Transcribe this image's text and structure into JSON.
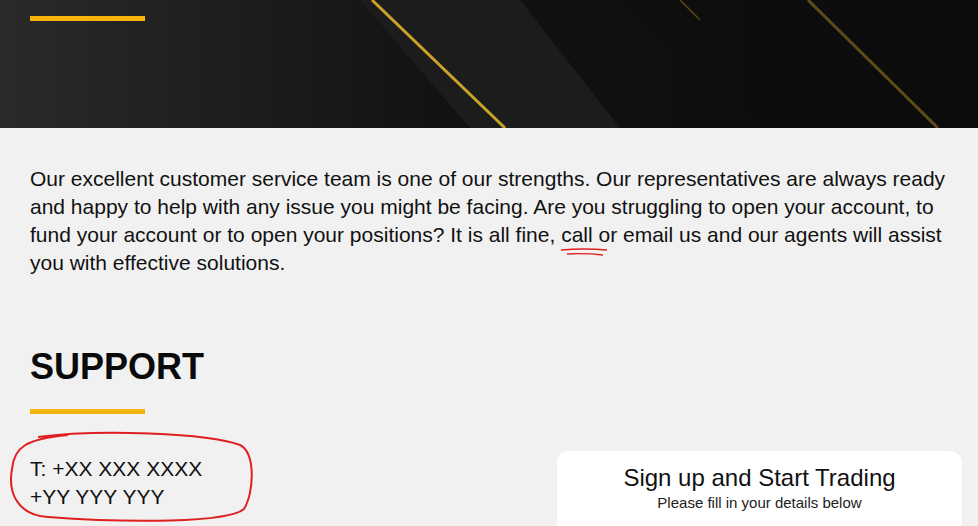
{
  "intro": {
    "before": "Our excellent customer service team is one of our strengths. Our representatives are always ready and happy to help with any issue you might be facing. Are you struggling to open your account, to fund your account or to open your positions? It is all fine, ",
    "highlight": {
      "text": "call",
      "marked": true
    },
    "after": " or email us and our agents will assist you with effective solutions."
  },
  "support": {
    "heading": "SUPPORT",
    "phones": [
      "T: +XX XXX XXXX",
      "+YY YYY YYY"
    ],
    "circled": true
  },
  "signup": {
    "title": "Sign up and Start Trading",
    "subtitle": "Please fill in your details below"
  }
}
